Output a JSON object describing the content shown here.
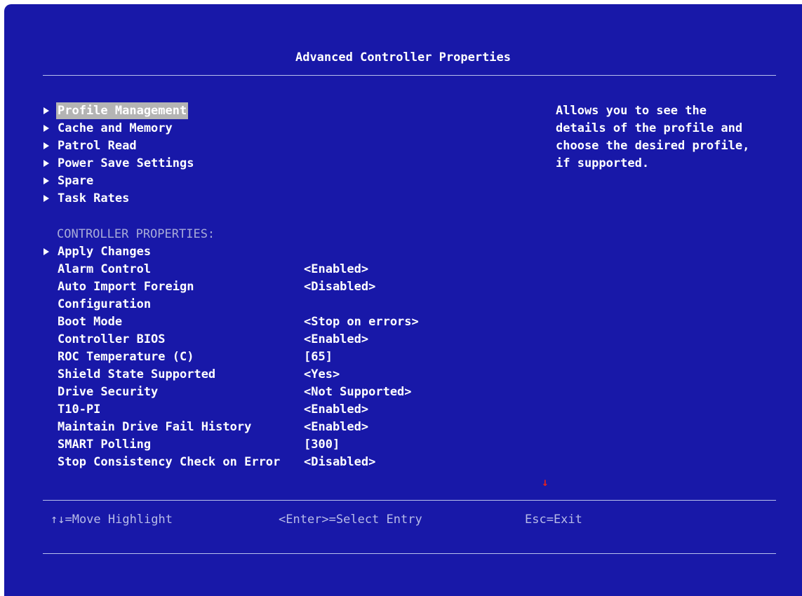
{
  "screen": {
    "title": "Advanced Controller Properties"
  },
  "menu": {
    "items": [
      {
        "label": "Profile Management",
        "selected": true
      },
      {
        "label": "Cache and Memory",
        "selected": false
      },
      {
        "label": "Patrol Read",
        "selected": false
      },
      {
        "label": "Power Save Settings",
        "selected": false
      },
      {
        "label": "Spare",
        "selected": false
      },
      {
        "label": "Task Rates",
        "selected": false
      }
    ]
  },
  "help": {
    "lines": [
      "Allows you to see the",
      "details of the profile and",
      "choose the desired profile,",
      "if supported."
    ]
  },
  "properties": {
    "section_heading": "CONTROLLER PROPERTIES:",
    "apply_changes": "Apply Changes",
    "rows": [
      {
        "label": "Alarm Control",
        "value": "<Enabled>"
      },
      {
        "label": "Auto Import Foreign",
        "value": "<Disabled>"
      },
      {
        "label": "Configuration",
        "value": ""
      },
      {
        "label": "Boot Mode",
        "value": "<Stop on errors>"
      },
      {
        "label": "Controller BIOS",
        "value": "<Enabled>"
      },
      {
        "label": "ROC Temperature (C)",
        "value": "[65]"
      },
      {
        "label": "Shield State Supported",
        "value": "<Yes>"
      },
      {
        "label": "Drive Security",
        "value": "<Not Supported>"
      },
      {
        "label": "T10-PI",
        "value": "<Enabled>"
      },
      {
        "label": "Maintain Drive Fail History",
        "value": "<Enabled>"
      },
      {
        "label": "SMART Polling",
        "value": "[300]"
      },
      {
        "label": "Stop Consistency Check on Error",
        "value": "<Disabled>"
      }
    ]
  },
  "footer": {
    "move": "↑↓=Move Highlight",
    "select": "<Enter>=Select Entry",
    "exit": "Esc=Exit"
  },
  "scroll_indicator": "↓",
  "colors": {
    "background": "#1818a8",
    "highlight": "#b4b4b4",
    "muted_text": "#a8acd8",
    "scroll_arrow": "#e02020"
  }
}
